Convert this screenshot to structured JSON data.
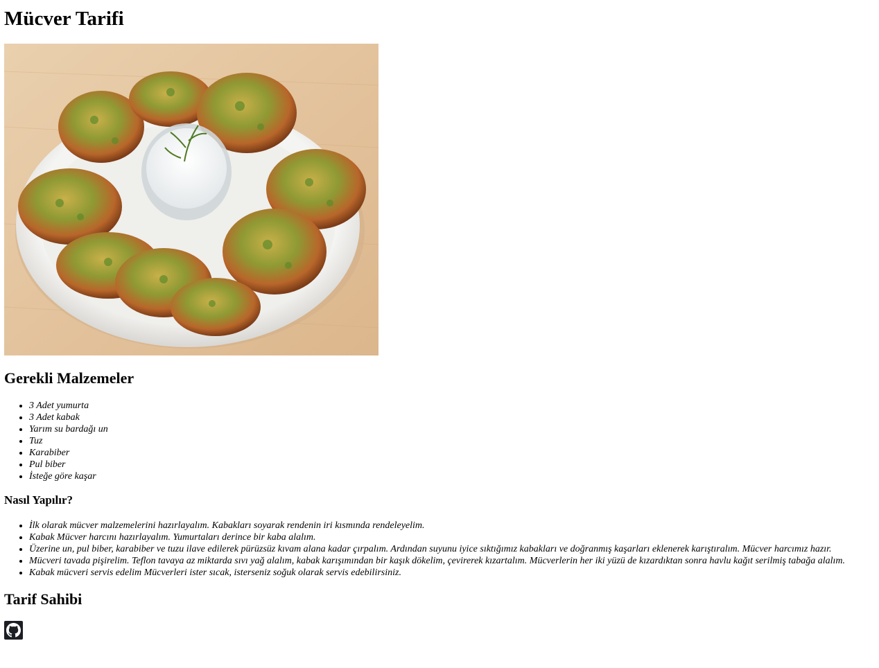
{
  "title": "Mücver Tarifi",
  "image": {
    "alt": "Mücver"
  },
  "ingredients": {
    "heading": "Gerekli Malzemeler",
    "items": [
      "3 Adet yumurta",
      "3 Adet kabak",
      "Yarım su bardağı un",
      "Tuz",
      "Karabiber",
      "Pul biber",
      "İsteğe göre kaşar"
    ]
  },
  "steps": {
    "heading": "Nasıl Yapılır?",
    "items": [
      "İlk olarak mücver malzemelerini hazırlayalım. Kabakları soyarak rendenin iri kısmında rendeleyelim.",
      "Kabak Mücver harcını hazırlayalım. Yumurtaları derince bir kaba alalım.",
      "Üzerine un, pul biber, karabiber ve tuzu ilave edilerek pürüzsüz kıvam alana kadar çırpalım. Ardından suyunu iyice sıktığımız kabakları ve doğranmış kaşarları eklenerek karıştıralım. Mücver harcımız hazır.",
      "Mücveri tavada pişirelim. Teflon tavaya az miktarda sıvı yağ alalım, kabak karışımından bir kaşık dökelim, çevirerek kızartalım. Mücverlerin her iki yüzü de kızardıktan sonra havlu kağıt serilmiş tabağa alalım.",
      "Kabak mücveri servis edelim Mücverleri ister sıcak, isterseniz soğuk olarak servis edebilirsiniz."
    ]
  },
  "owner": {
    "heading": "Tarif Sahibi",
    "icon": "github-icon"
  }
}
